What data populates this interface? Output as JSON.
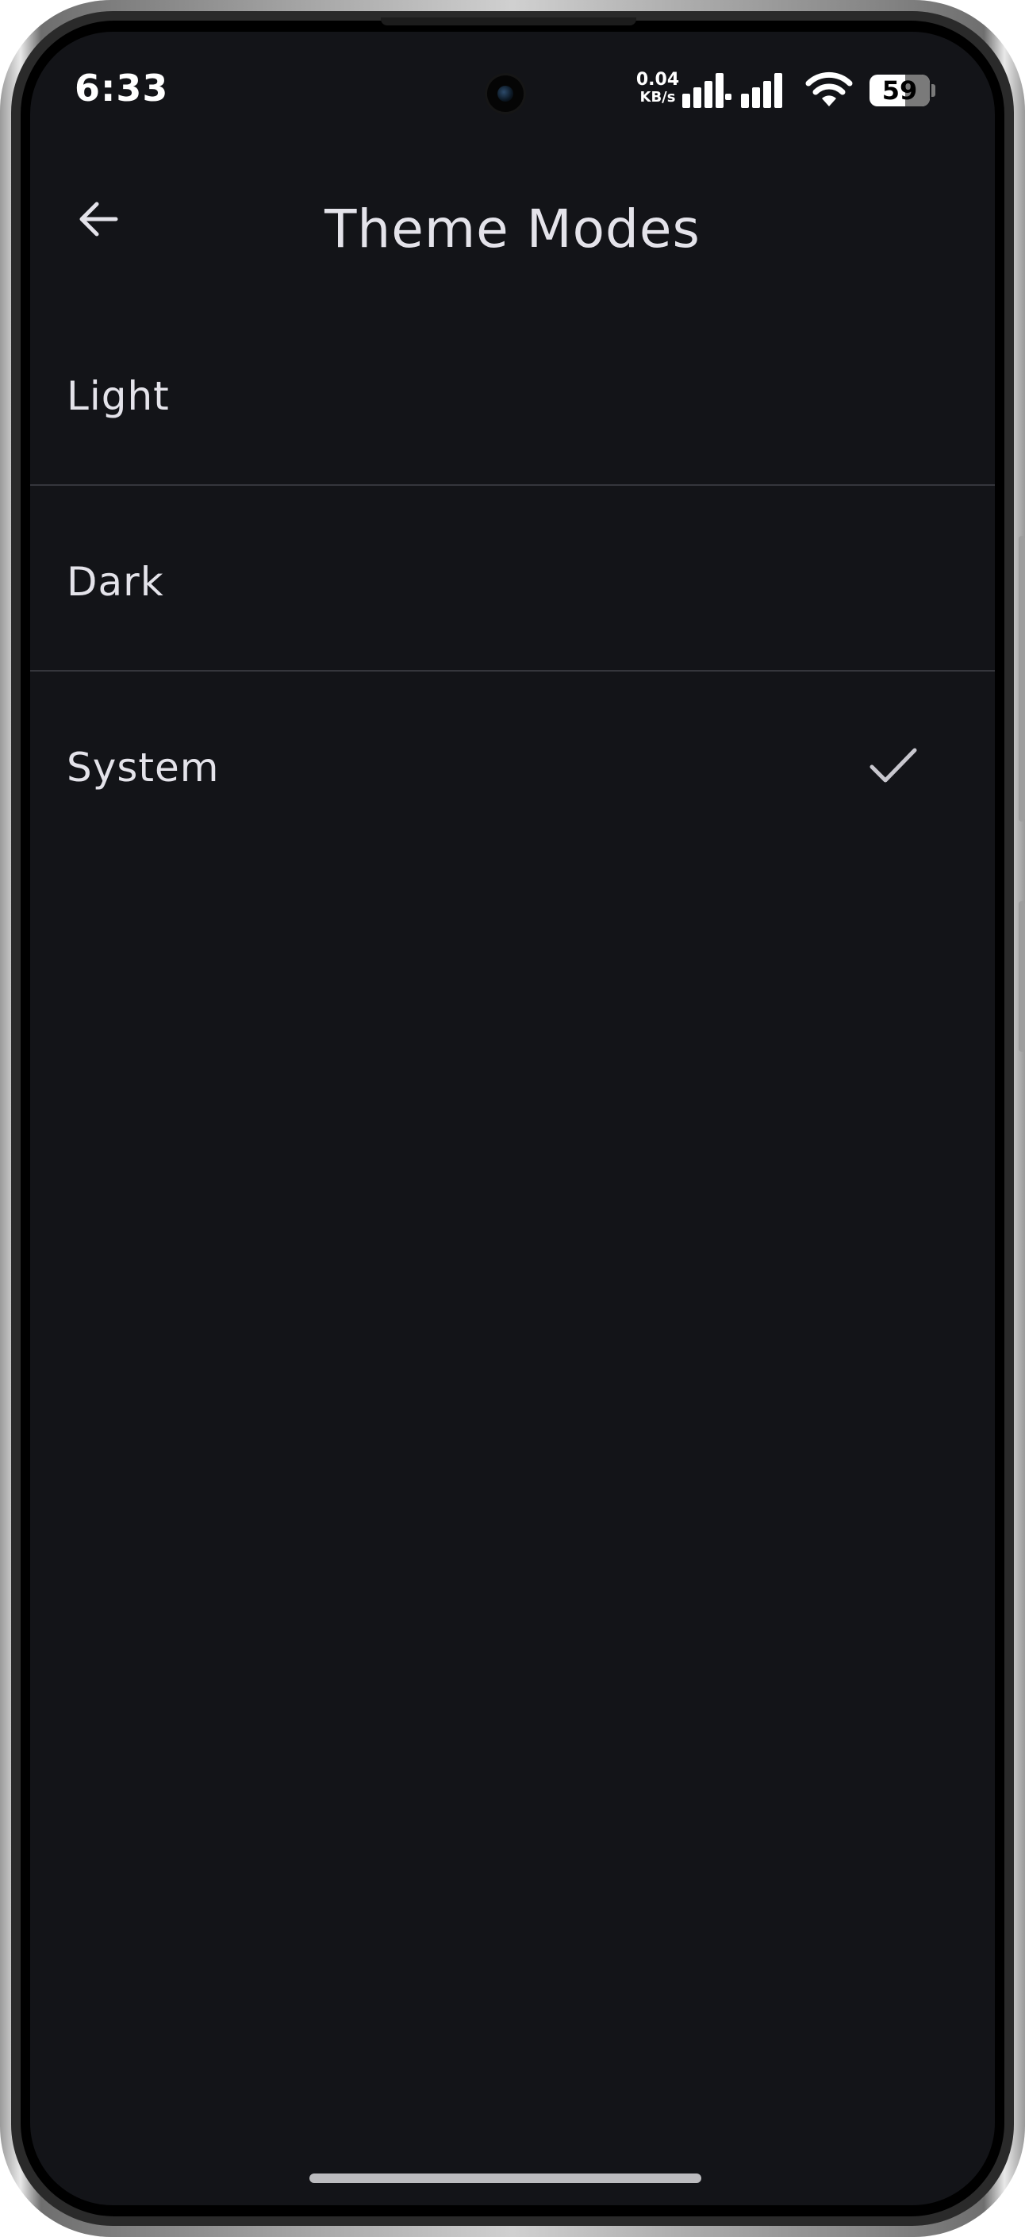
{
  "status_bar": {
    "time": "6:33",
    "net_speed_value": "0.04",
    "net_speed_unit": "KB/s",
    "signal_icons": [
      "signal-strength-icon",
      "signal-strength-icon"
    ],
    "wifi_icon": "wifi-icon",
    "battery_level": "59"
  },
  "app_bar": {
    "back_icon": "arrow-left-icon",
    "title": "Theme Modes"
  },
  "theme_options": [
    {
      "label": "Light",
      "selected": false
    },
    {
      "label": "Dark",
      "selected": false
    },
    {
      "label": "System",
      "selected": true
    }
  ],
  "colors": {
    "background": "#131418",
    "text": "#e4e3ea",
    "divider": "#35363c",
    "check": "#c8c7ce"
  }
}
